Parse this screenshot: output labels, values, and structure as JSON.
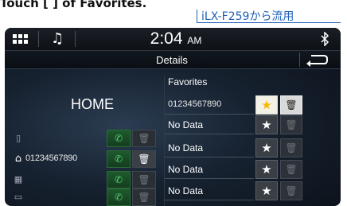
{
  "doc": {
    "heading": "Touch [ ] of Favorites.",
    "note": "iLX-F259から流用"
  },
  "statusbar": {
    "clock": "2:04",
    "ampm": "AM",
    "icons": [
      "menu-grid-icon",
      "music-note-icon",
      "bluetooth-icon"
    ]
  },
  "titlebar": {
    "title": "Details",
    "back_icon": "back-arrow-icon"
  },
  "contact": {
    "name": "HOME",
    "numbers": [
      {
        "type_icon": "mobile-phone-icon",
        "number": "",
        "active": false
      },
      {
        "type_icon": "home-icon",
        "number": "01234567890",
        "active": true
      },
      {
        "type_icon": "office-building-icon",
        "number": "",
        "active": false
      },
      {
        "type_icon": "other-phone-icon",
        "number": "",
        "active": false
      }
    ]
  },
  "favorites": {
    "title": "Favorites",
    "items": [
      {
        "label": "01234567890",
        "favorited": true
      },
      {
        "label": "No Data",
        "favorited": false
      },
      {
        "label": "No Data",
        "favorited": false
      },
      {
        "label": "No Data",
        "favorited": false
      },
      {
        "label": "No Data",
        "favorited": false
      }
    ]
  },
  "colors": {
    "accent_blue": "#1f5fb8",
    "star_yellow": "#f5b700",
    "call_green": "#4fd070"
  }
}
